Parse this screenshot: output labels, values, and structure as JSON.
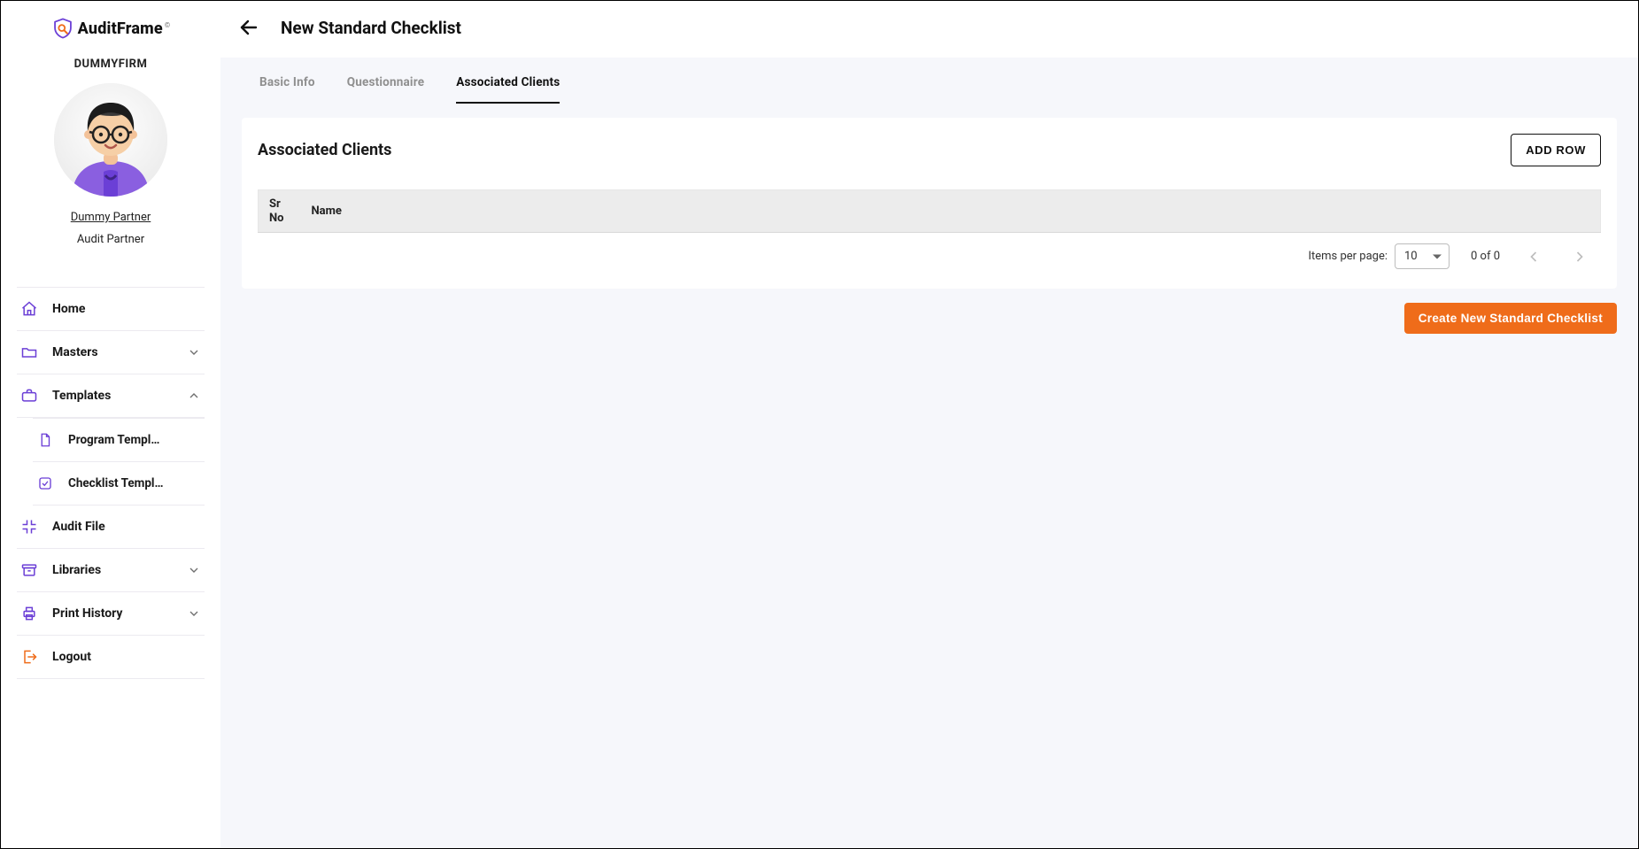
{
  "brand": {
    "name": "AuditFrame",
    "reg": "©"
  },
  "sidebar": {
    "firm": "DUMMYFIRM",
    "user_name": "Dummy Partner",
    "user_role": "Audit Partner",
    "items": [
      {
        "label": "Home"
      },
      {
        "label": "Masters"
      },
      {
        "label": "Templates"
      },
      {
        "label": "Audit File"
      },
      {
        "label": "Libraries"
      },
      {
        "label": "Print History"
      },
      {
        "label": "Logout"
      }
    ],
    "templates_children": [
      {
        "label": "Program Templ…"
      },
      {
        "label": "Checklist Templ…"
      }
    ]
  },
  "header": {
    "title": "New Standard Checklist"
  },
  "tabs": [
    {
      "label": "Basic Info",
      "active": false
    },
    {
      "label": "Questionnaire",
      "active": false
    },
    {
      "label": "Associated Clients",
      "active": true
    }
  ],
  "panel": {
    "title": "Associated Clients",
    "add_row_label": "ADD ROW",
    "columns": {
      "srno": "Sr No",
      "name": "Name"
    },
    "rows": []
  },
  "paginator": {
    "items_per_page_label": "Items per page:",
    "page_size": "10",
    "range": "0 of 0"
  },
  "actions": {
    "create_label": "Create New Standard Checklist"
  }
}
